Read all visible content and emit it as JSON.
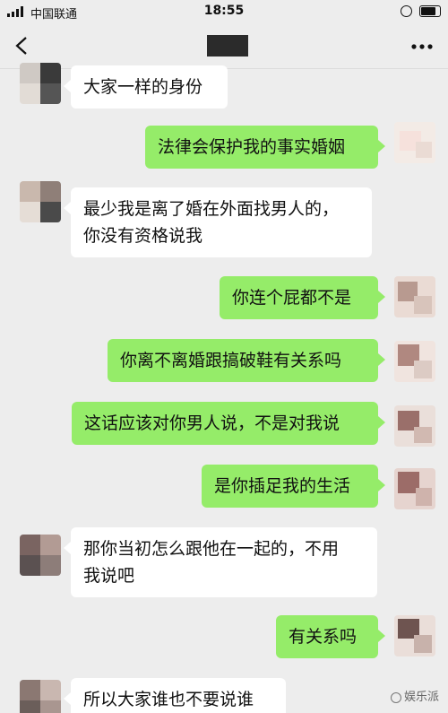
{
  "status_bar": {
    "carrier": "中国联通",
    "time": "18:55"
  },
  "nav": {
    "back_icon": "chevron-left-icon",
    "more_icon": "ellipsis-icon"
  },
  "colors": {
    "background": "#ededed",
    "incoming_bubble": "#ffffff",
    "outgoing_bubble": "#95ec69"
  },
  "messages": [
    {
      "direction": "in",
      "text": "大家一样的身份"
    },
    {
      "direction": "out",
      "text": "法律会保护我的事实婚姻"
    },
    {
      "direction": "in",
      "text": "最少我是离了婚在外面找男人的，\n你没有资格说我"
    },
    {
      "direction": "out",
      "text": "你连个屁都不是"
    },
    {
      "direction": "out",
      "text": "你离不离婚跟搞破鞋有关系吗"
    },
    {
      "direction": "out",
      "text": "这话应该对你男人说，不是对我说"
    },
    {
      "direction": "out",
      "text": "是你插足我的生活"
    },
    {
      "direction": "in",
      "text": "那你当初怎么跟他在一起的，不用\n我说吧"
    },
    {
      "direction": "out",
      "text": "有关系吗"
    },
    {
      "direction": "in",
      "text": "所以大家谁也不要说谁"
    }
  ],
  "watermark": "娱乐派"
}
